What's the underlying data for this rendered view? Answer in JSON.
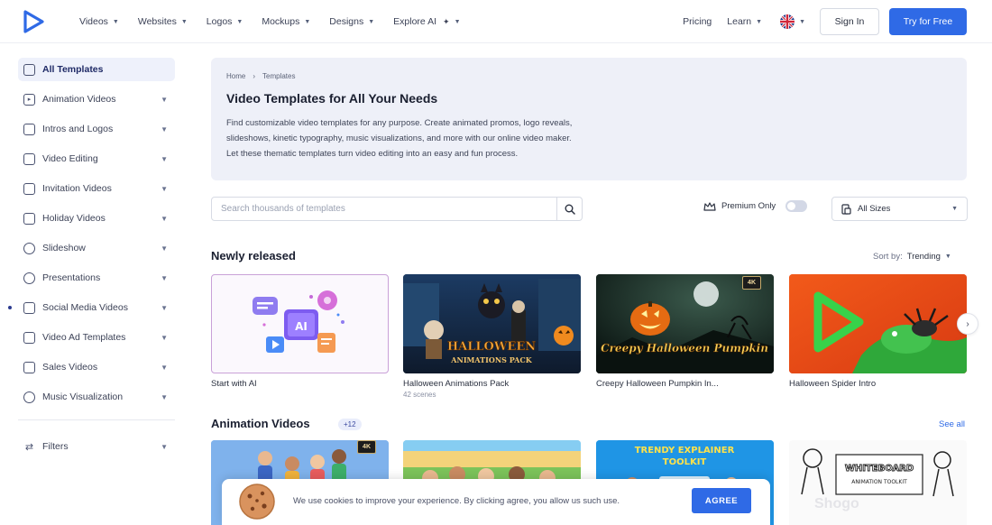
{
  "header": {
    "nav": [
      {
        "label": "Videos"
      },
      {
        "label": "Websites"
      },
      {
        "label": "Logos"
      },
      {
        "label": "Mockups"
      },
      {
        "label": "Designs"
      },
      {
        "label": "Explore AI"
      }
    ],
    "pricing": "Pricing",
    "learn": "Learn",
    "signin": "Sign In",
    "try_free": "Try for Free"
  },
  "sidebar": {
    "items": [
      {
        "label": "All Templates"
      },
      {
        "label": "Animation Videos"
      },
      {
        "label": "Intros and Logos"
      },
      {
        "label": "Video Editing"
      },
      {
        "label": "Invitation Videos"
      },
      {
        "label": "Holiday Videos"
      },
      {
        "label": "Slideshow"
      },
      {
        "label": "Presentations"
      },
      {
        "label": "Social Media Videos"
      },
      {
        "label": "Video Ad Templates"
      },
      {
        "label": "Sales Videos"
      },
      {
        "label": "Music Visualization"
      }
    ],
    "filters": "Filters"
  },
  "hero": {
    "breadcrumb_home": "Home",
    "breadcrumb_sep": "›",
    "breadcrumb_current": "Templates",
    "title": "Video Templates for All Your Needs",
    "desc_line1": "Find customizable video templates for any purpose. Create animated promos, logo reveals,",
    "desc_line2": "slideshows, kinetic typography, music visualizations, and more with our online video maker.",
    "desc_line3": "Let these thematic templates turn video editing into an easy and fun process."
  },
  "search": {
    "placeholder": "Search thousands of templates"
  },
  "filters_bar": {
    "premium_label": "Premium Only",
    "sizes_label": "All Sizes"
  },
  "newly_released": {
    "title": "Newly released",
    "sort_label": "Sort by:",
    "sort_value": "Trending",
    "cards": [
      {
        "title": "Start with AI",
        "image_text": "AI"
      },
      {
        "title": "Halloween Animations Pack",
        "subtitle": "42 scenes",
        "image_text": "HALLOWEEN ANIMATIONS PACK"
      },
      {
        "title": "Creepy Halloween Pumpkin In...",
        "image_text": "Creepy Halloween Pumpkin",
        "badge": "4K"
      },
      {
        "title": "Halloween Spider Intro"
      }
    ]
  },
  "animation_videos": {
    "title": "Animation Videos",
    "count": "+12",
    "see_all": "See all",
    "cards": [
      {
        "badge": "4K"
      },
      {},
      {
        "image_text": "TRENDY EXPLAINER TOOLKIT"
      },
      {
        "image_text": "WHITEBOARD ANIMATION TOOLKIT"
      }
    ]
  },
  "cookie": {
    "text": "We use cookies to improve your experience. By clicking agree, you allow us such use.",
    "agree": "AGREE"
  },
  "watermark": "Shogo",
  "colors": {
    "accent": "#2f6ae6",
    "hero_bg": "#eef0f8",
    "sidebar_active_bg": "#eef1fb"
  }
}
